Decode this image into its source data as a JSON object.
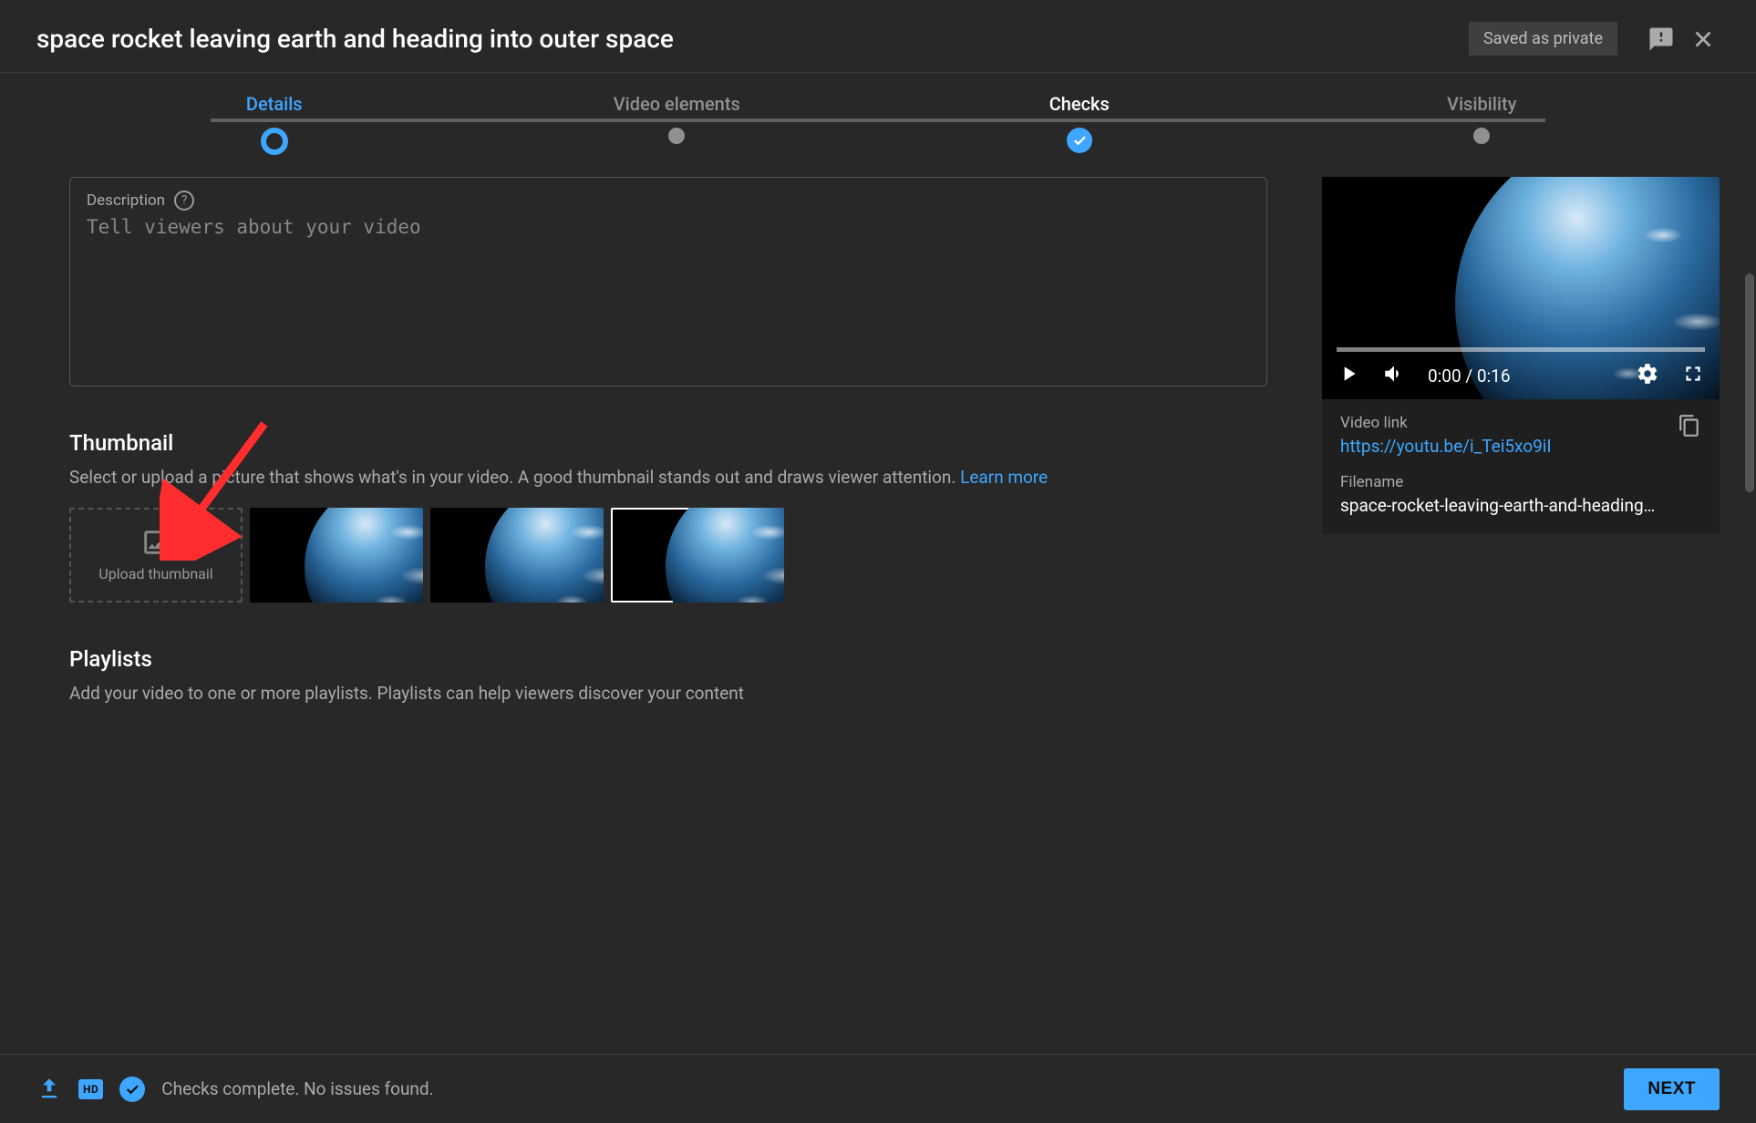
{
  "header": {
    "title": "space rocket leaving earth and heading into outer space",
    "saved_label": "Saved as private"
  },
  "stepper": {
    "steps": [
      {
        "label": "Details",
        "state": "active"
      },
      {
        "label": "Video elements",
        "state": "idle"
      },
      {
        "label": "Checks",
        "state": "done"
      },
      {
        "label": "Visibility",
        "state": "idle"
      }
    ]
  },
  "description": {
    "label": "Description",
    "placeholder": "Tell viewers about your video"
  },
  "thumbnail": {
    "title": "Thumbnail",
    "help_text_1": "Select or upload a picture that shows what's in your video. A good thumbnail stands out and draws viewer attention. ",
    "learn_more": "Learn more",
    "upload_label": "Upload thumbnail"
  },
  "playlists": {
    "title": "Playlists",
    "help_text": "Add your video to one or more playlists. Playlists can help viewers discover your content"
  },
  "preview": {
    "time": "0:00 / 0:16",
    "link_label": "Video link",
    "link_url": "https://youtu.be/i_Tei5xo9iI",
    "filename_label": "Filename",
    "filename_value": "space-rocket-leaving-earth-and-heading…"
  },
  "footer": {
    "status": "Checks complete. No issues found.",
    "next_label": "NEXT",
    "hd_label": "HD"
  }
}
